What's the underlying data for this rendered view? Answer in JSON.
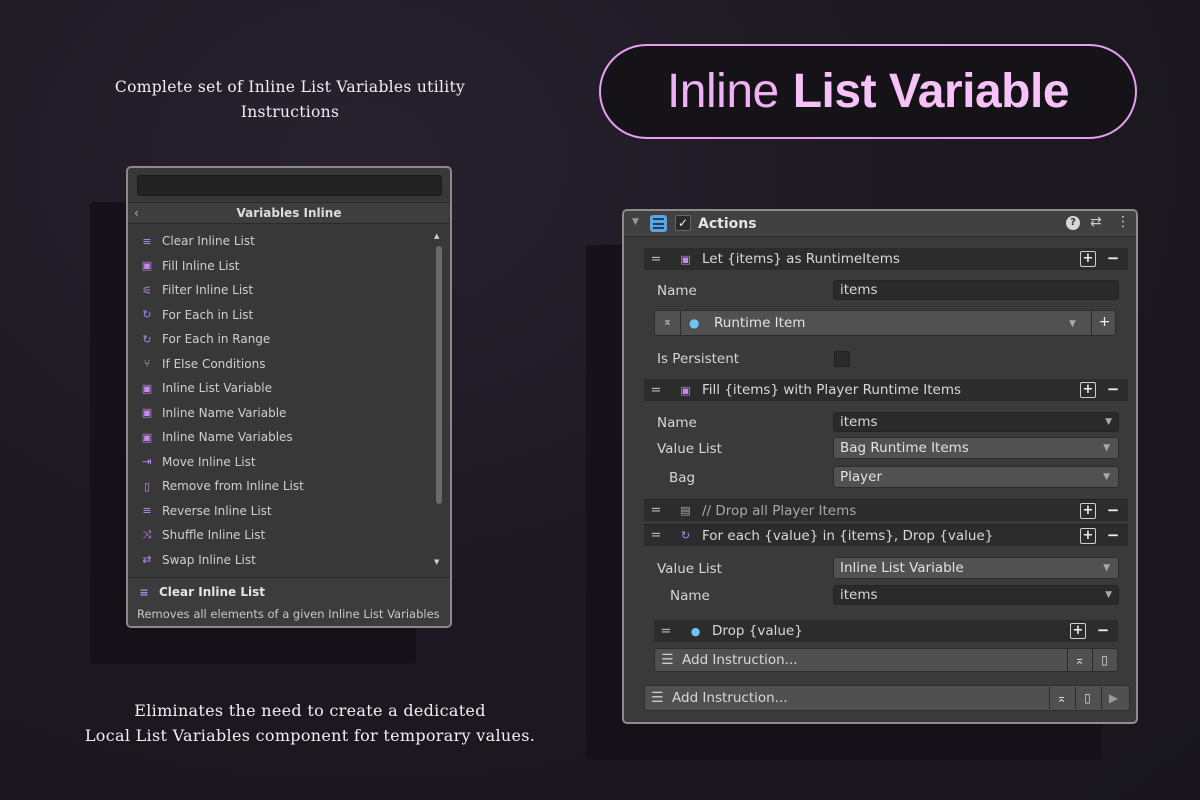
{
  "captions": {
    "top_line1": "Complete set of Inline List Variables utility",
    "top_line2": "Instructions",
    "bottom_line1": "Eliminates the need to create a dedicated",
    "bottom_line2": "Local List Variables component for temporary values."
  },
  "title": {
    "thin": "Inline",
    "bold": "List Variable"
  },
  "variables_panel": {
    "header": "Variables Inline",
    "back": "‹",
    "items": [
      {
        "label": "Clear Inline List",
        "icon": "clear-icon",
        "color": "#b98be8"
      },
      {
        "label": "Fill Inline List",
        "icon": "fill-icon",
        "color": "#c58af0"
      },
      {
        "label": "Filter Inline List",
        "icon": "filter-icon",
        "color": "#b98be8"
      },
      {
        "label": "For Each in List",
        "icon": "loop-icon",
        "color": "#9d8cf2"
      },
      {
        "label": "For Each in Range",
        "icon": "loop-icon",
        "color": "#9d8cf2"
      },
      {
        "label": "If Else Conditions",
        "icon": "branch-icon",
        "color": "#8fe36b"
      },
      {
        "label": "Inline List Variable",
        "icon": "list-variable-icon",
        "color": "#c58af0"
      },
      {
        "label": "Inline Name Variable",
        "icon": "name-variable-icon",
        "color": "#c58af0"
      },
      {
        "label": "Inline Name Variables",
        "icon": "name-variable-icon",
        "color": "#c58af0"
      },
      {
        "label": "Move Inline List",
        "icon": "move-icon",
        "color": "#c58af0"
      },
      {
        "label": "Remove from Inline List",
        "icon": "trash-icon",
        "color": "#c58af0"
      },
      {
        "label": "Reverse Inline List",
        "icon": "reverse-icon",
        "color": "#c58af0"
      },
      {
        "label": "Shuffle Inline List",
        "icon": "shuffle-icon",
        "color": "#c58af0"
      },
      {
        "label": "Swap Inline List",
        "icon": "swap-icon",
        "color": "#c58af0"
      }
    ],
    "selected_title": "Clear Inline List",
    "selected_description": "Removes all elements of a given Inline List Variables"
  },
  "actions_panel": {
    "header": "Actions",
    "help_icon": "?",
    "let_row": {
      "label": "Let {items} as RuntimeItems"
    },
    "let_fields": {
      "name_label": "Name",
      "name_value": "items",
      "type_value": "Runtime Item",
      "persistent_label": "Is Persistent"
    },
    "fill_row": {
      "label": "Fill {items} with Player Runtime Items"
    },
    "fill_fields": {
      "name_label": "Name",
      "name_value": "items",
      "value_list_label": "Value List",
      "value_list_value": "Bag Runtime Items",
      "bag_label": "Bag",
      "bag_value": "Player"
    },
    "comment_row": {
      "label": "// Drop all Player Items"
    },
    "foreach_row": {
      "label": "For each {value} in {items}, Drop {value}"
    },
    "foreach_fields": {
      "value_list_label": "Value List",
      "value_list_value": "Inline List Variable",
      "name_label": "Name",
      "name_value": "items"
    },
    "drop_row": {
      "label": "Drop {value}"
    },
    "inner_add": "Add Instruction...",
    "outer_add": "Add Instruction..."
  }
}
